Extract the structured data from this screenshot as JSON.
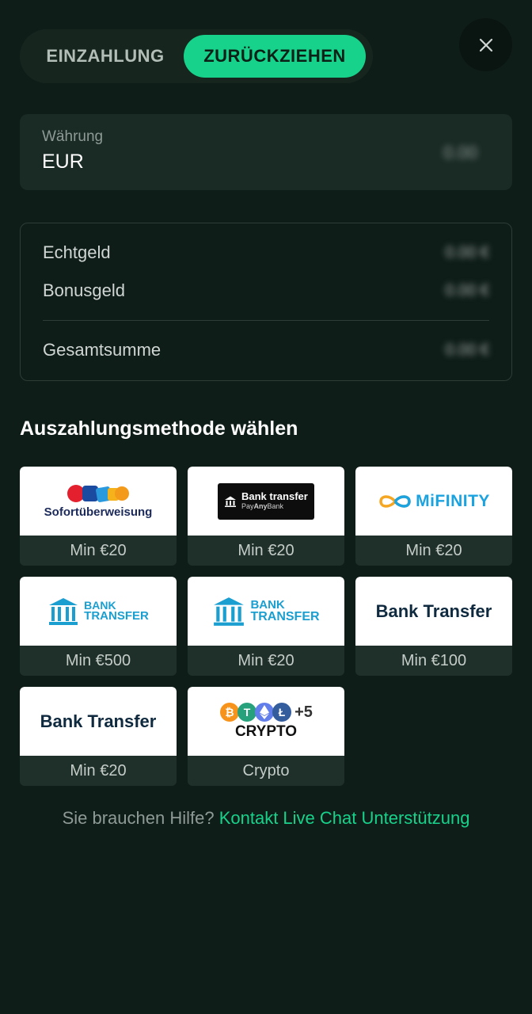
{
  "tabs": {
    "deposit": "EINZAHLUNG",
    "withdraw": "ZURÜCKZIEHEN"
  },
  "currency": {
    "label": "Währung",
    "value": "EUR",
    "balance": "0.00"
  },
  "balances": {
    "real_label": "Echtgeld",
    "real_amount": "0.00 €",
    "bonus_label": "Bonusgeld",
    "bonus_amount": "0.00 €",
    "total_label": "Gesamtsumme",
    "total_amount": "0.00 €"
  },
  "section_title": "Auszahlungsmethode wählen",
  "methods": [
    {
      "logo_text": "Sofortüberweisung",
      "min": "Min €20",
      "icon": "sofort-logo"
    },
    {
      "logo_text": "Bank transfer",
      "logo_sub_pre": "Pay",
      "logo_sub_bold": "Any",
      "logo_sub_post": "Bank",
      "min": "Min €20",
      "icon": "bank-icon"
    },
    {
      "logo_text": "MiFINITY",
      "min": "Min €20",
      "icon": "infinity-icon"
    },
    {
      "logo_text_1": "BANK",
      "logo_text_2": "TRANSFER",
      "min": "Min €500",
      "icon": "bank-building-icon"
    },
    {
      "logo_text_1": "BANK",
      "logo_text_2": "TRANSFER",
      "min": "Min €20",
      "icon": "bank-building-icon"
    },
    {
      "logo_text": "Bank Transfer",
      "min": "Min €100"
    },
    {
      "logo_text": "Bank Transfer",
      "min": "Min €20"
    },
    {
      "logo_text": "CRYPTO",
      "logo_extra": "+5",
      "min": "Crypto",
      "icon": "crypto-coins-icon"
    }
  ],
  "help": {
    "text": "Sie brauchen Hilfe?",
    "link": "Kontakt Live Chat Unterstützung"
  },
  "colors": {
    "background": "#0f1d19",
    "accent": "#17d28a",
    "panel": "#1a2a24"
  }
}
